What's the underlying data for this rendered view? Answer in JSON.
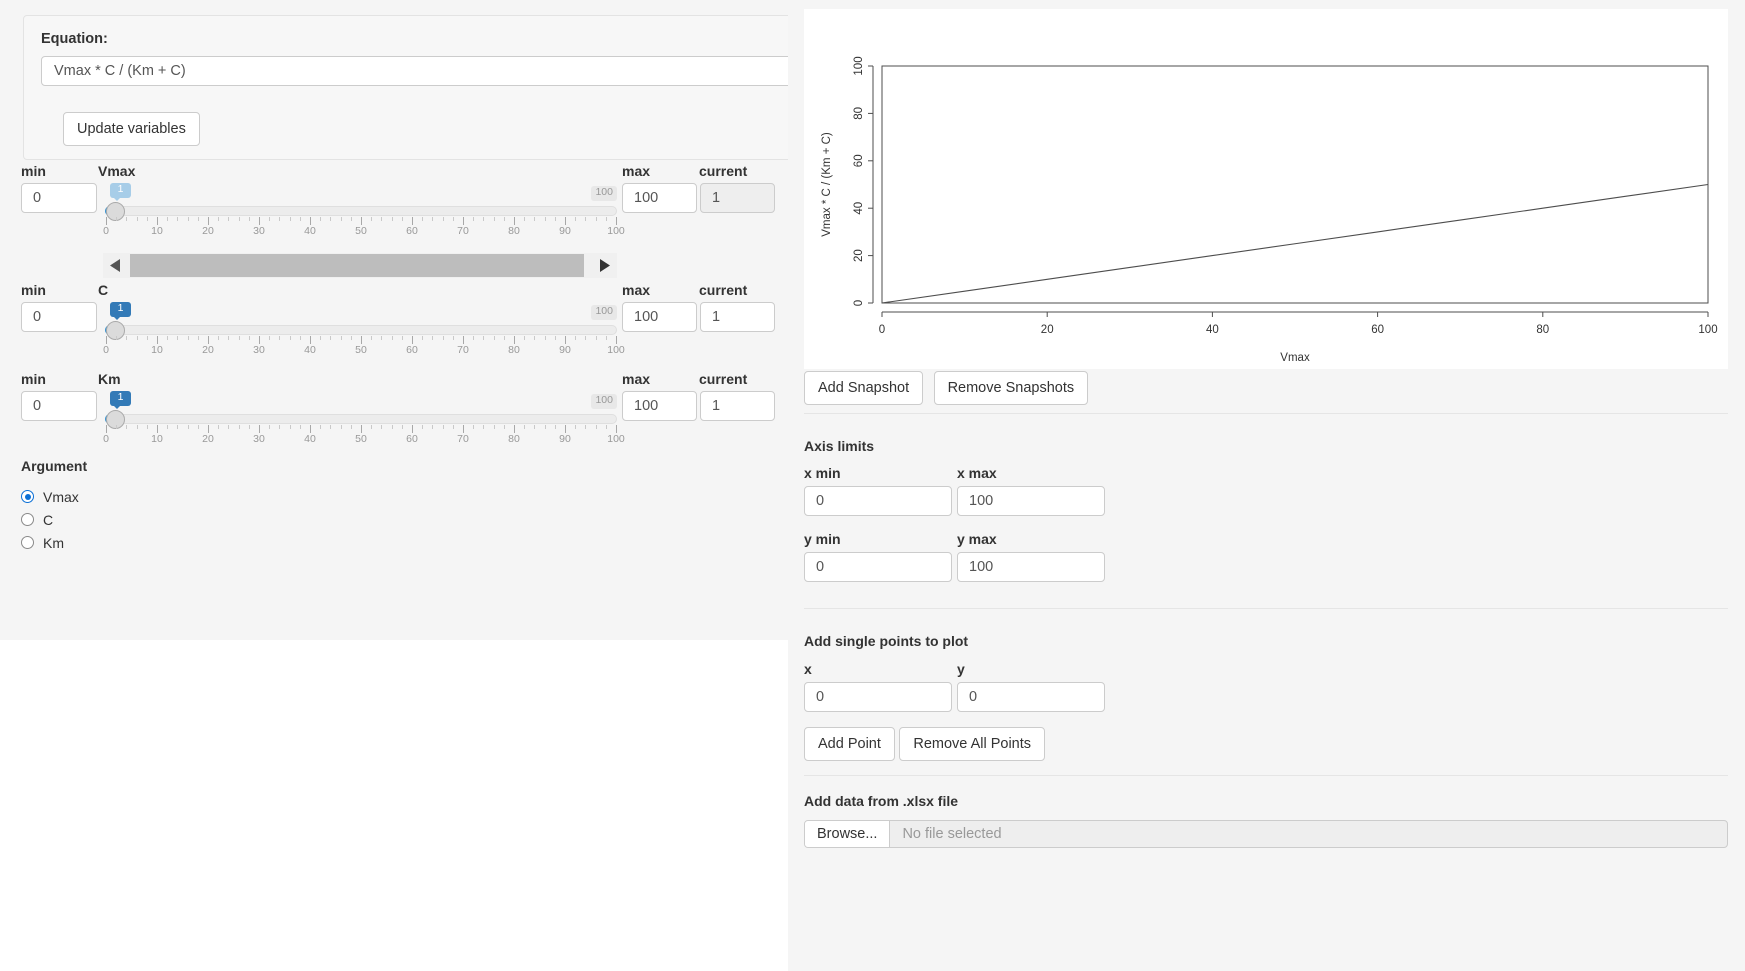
{
  "left": {
    "equation_section": {
      "label": "Equation:",
      "value": "Vmax * C / (Km + C)",
      "placeholder": "Vmax * C / (Km + C)",
      "update_button": "Update variables"
    },
    "column_headers": {
      "min": "min",
      "max": "max",
      "current": "current"
    },
    "sliders": [
      {
        "name": "Vmax",
        "min": "0",
        "max": "100",
        "current": "1",
        "current_disabled": true,
        "tooltip": "1",
        "limit_badge": "100",
        "tick_labels": [
          "0",
          "10",
          "20",
          "30",
          "40",
          "50",
          "60",
          "70",
          "80",
          "90",
          "100"
        ],
        "has_scrollbar": true
      },
      {
        "name": "C",
        "min": "0",
        "max": "100",
        "current": "1",
        "current_disabled": false,
        "tooltip": "1",
        "limit_badge": "100",
        "tick_labels": [
          "0",
          "10",
          "20",
          "30",
          "40",
          "50",
          "60",
          "70",
          "80",
          "90",
          "100"
        ],
        "has_scrollbar": false
      },
      {
        "name": "Km",
        "min": "0",
        "max": "100",
        "current": "1",
        "current_disabled": false,
        "tooltip": "1",
        "limit_badge": "100",
        "tick_labels": [
          "0",
          "10",
          "20",
          "30",
          "40",
          "50",
          "60",
          "70",
          "80",
          "90",
          "100"
        ],
        "has_scrollbar": false
      }
    ],
    "argument": {
      "title": "Argument",
      "options": [
        "Vmax",
        "C",
        "Km"
      ],
      "selected": "Vmax"
    }
  },
  "right": {
    "snapshot_buttons": {
      "add": "Add Snapshot",
      "remove": "Remove Snapshots"
    },
    "axis_limits": {
      "title": "Axis limits",
      "x_min_label": "x min",
      "x_min_value": "0",
      "x_max_label": "x max",
      "x_max_value": "100",
      "y_min_label": "y min",
      "y_min_value": "0",
      "y_max_label": "y max",
      "y_max_value": "100"
    },
    "add_points": {
      "title": "Add single points to plot",
      "x_label": "x",
      "x_value": "0",
      "y_label": "y",
      "y_value": "0",
      "add_button": "Add Point",
      "remove_button": "Remove All Points"
    },
    "file_upload": {
      "title": "Add data from .xlsx file",
      "browse_label": "Browse...",
      "status": "No file selected"
    }
  },
  "chart_data": {
    "type": "line",
    "title": "",
    "xlabel": "Vmax",
    "ylabel": "Vmax * C / (Km + C)",
    "xlim": [
      0,
      100
    ],
    "ylim": [
      0,
      100
    ],
    "xticks": [
      0,
      20,
      40,
      60,
      80,
      100
    ],
    "yticks": [
      0,
      20,
      40,
      60,
      80,
      100
    ],
    "grid": false,
    "legend": null,
    "line_color": "#4d4d4d",
    "series": [
      {
        "name": "Vmax * C / (Km + C)",
        "x": [
          0,
          10,
          20,
          30,
          40,
          50,
          60,
          70,
          80,
          90,
          100
        ],
        "y": [
          0,
          5,
          10,
          15,
          20,
          25,
          30,
          35,
          40,
          45,
          50
        ]
      }
    ]
  }
}
